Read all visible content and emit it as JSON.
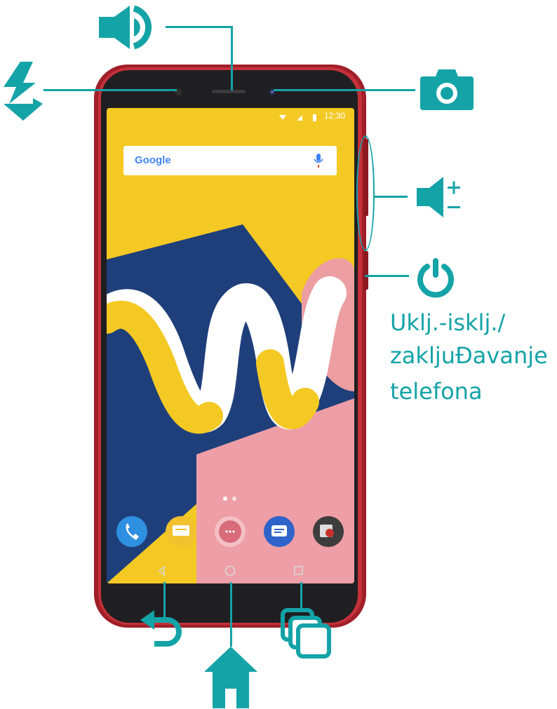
{
  "labels": {
    "power_line1": "Uklj.-isklj./",
    "power_line2": "zakljuĐavanje",
    "power_line3": "telefona"
  },
  "phone": {
    "status_time": "12:30",
    "search_brand": "Google"
  },
  "icons": {
    "speaker": "speaker-icon",
    "flash": "flash-icon",
    "camera": "camera-icon",
    "volume": "volume-icon",
    "power": "power-icon",
    "back": "back-icon",
    "home": "home-icon",
    "recent_apps": "recent-apps-icon"
  },
  "colors": {
    "accent": "#14a3a7",
    "phone_frame": "#b3262e",
    "wallpaper_yellow": "#f4c923",
    "wallpaper_blue": "#1e3f7a",
    "wallpaper_pink": "#ec9ea2"
  }
}
